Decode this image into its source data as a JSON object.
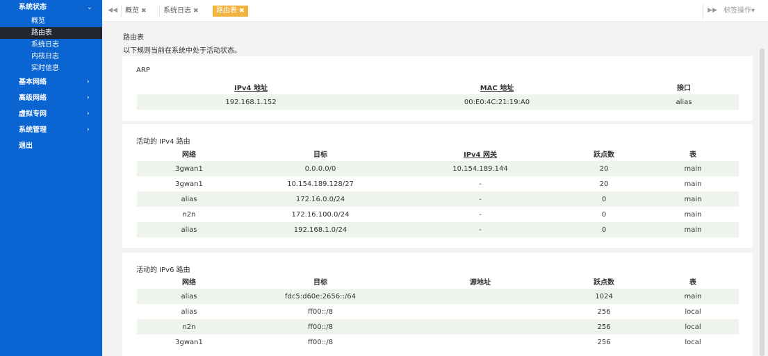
{
  "sidebar": {
    "sections": [
      {
        "label": "系统状态",
        "chevron": "⌄"
      },
      {
        "label": "基本网络",
        "chevron": "›"
      },
      {
        "label": "高级网络",
        "chevron": "›"
      },
      {
        "label": "虚拟专网",
        "chevron": "›"
      },
      {
        "label": "系统管理",
        "chevron": "›"
      },
      {
        "label": "退出",
        "chevron": ""
      }
    ],
    "sub_items": [
      "概览",
      "路由表",
      "系统日志",
      "内核日志",
      "实时信息"
    ]
  },
  "tabs": {
    "left_nav": "◀◀",
    "items": [
      {
        "label": "概览",
        "close": "✖"
      },
      {
        "label": "系统日志",
        "close": "✖"
      },
      {
        "label": "路由表",
        "close": "✖"
      }
    ],
    "right_nav": "▶▶",
    "ops_label": "标签操作▾"
  },
  "page": {
    "title": "路由表",
    "description": "以下规则当前在系统中处于活动状态。"
  },
  "arp": {
    "title": "ARP",
    "headers": [
      "IPv4 地址",
      "MAC 地址",
      "接口"
    ],
    "rows": [
      [
        "192.168.1.152",
        "00:E0:4C:21:19:A0",
        "alias"
      ]
    ]
  },
  "ipv4": {
    "title": "活动的 IPv4 路由",
    "headers": [
      "网络",
      "目标",
      "IPv4 网关",
      "跃点数",
      "表"
    ],
    "rows": [
      [
        "3gwan1",
        "0.0.0.0/0",
        "10.154.189.144",
        "20",
        "main"
      ],
      [
        "3gwan1",
        "10.154.189.128/27",
        "-",
        "20",
        "main"
      ],
      [
        "alias",
        "172.16.0.0/24",
        "-",
        "0",
        "main"
      ],
      [
        "n2n",
        "172.16.100.0/24",
        "-",
        "0",
        "main"
      ],
      [
        "alias",
        "192.168.1.0/24",
        "-",
        "0",
        "main"
      ]
    ]
  },
  "ipv6": {
    "title": "活动的 IPv6 路由",
    "headers": [
      "网络",
      "目标",
      "源地址",
      "跃点数",
      "表"
    ],
    "rows": [
      [
        "alias",
        "fdc5:d60e:2656::/64",
        "",
        "1024",
        "main"
      ],
      [
        "alias",
        "ff00::/8",
        "",
        "256",
        "local"
      ],
      [
        "n2n",
        "ff00::/8",
        "",
        "256",
        "local"
      ],
      [
        "3gwan1",
        "ff00::/8",
        "",
        "256",
        "local"
      ]
    ]
  }
}
